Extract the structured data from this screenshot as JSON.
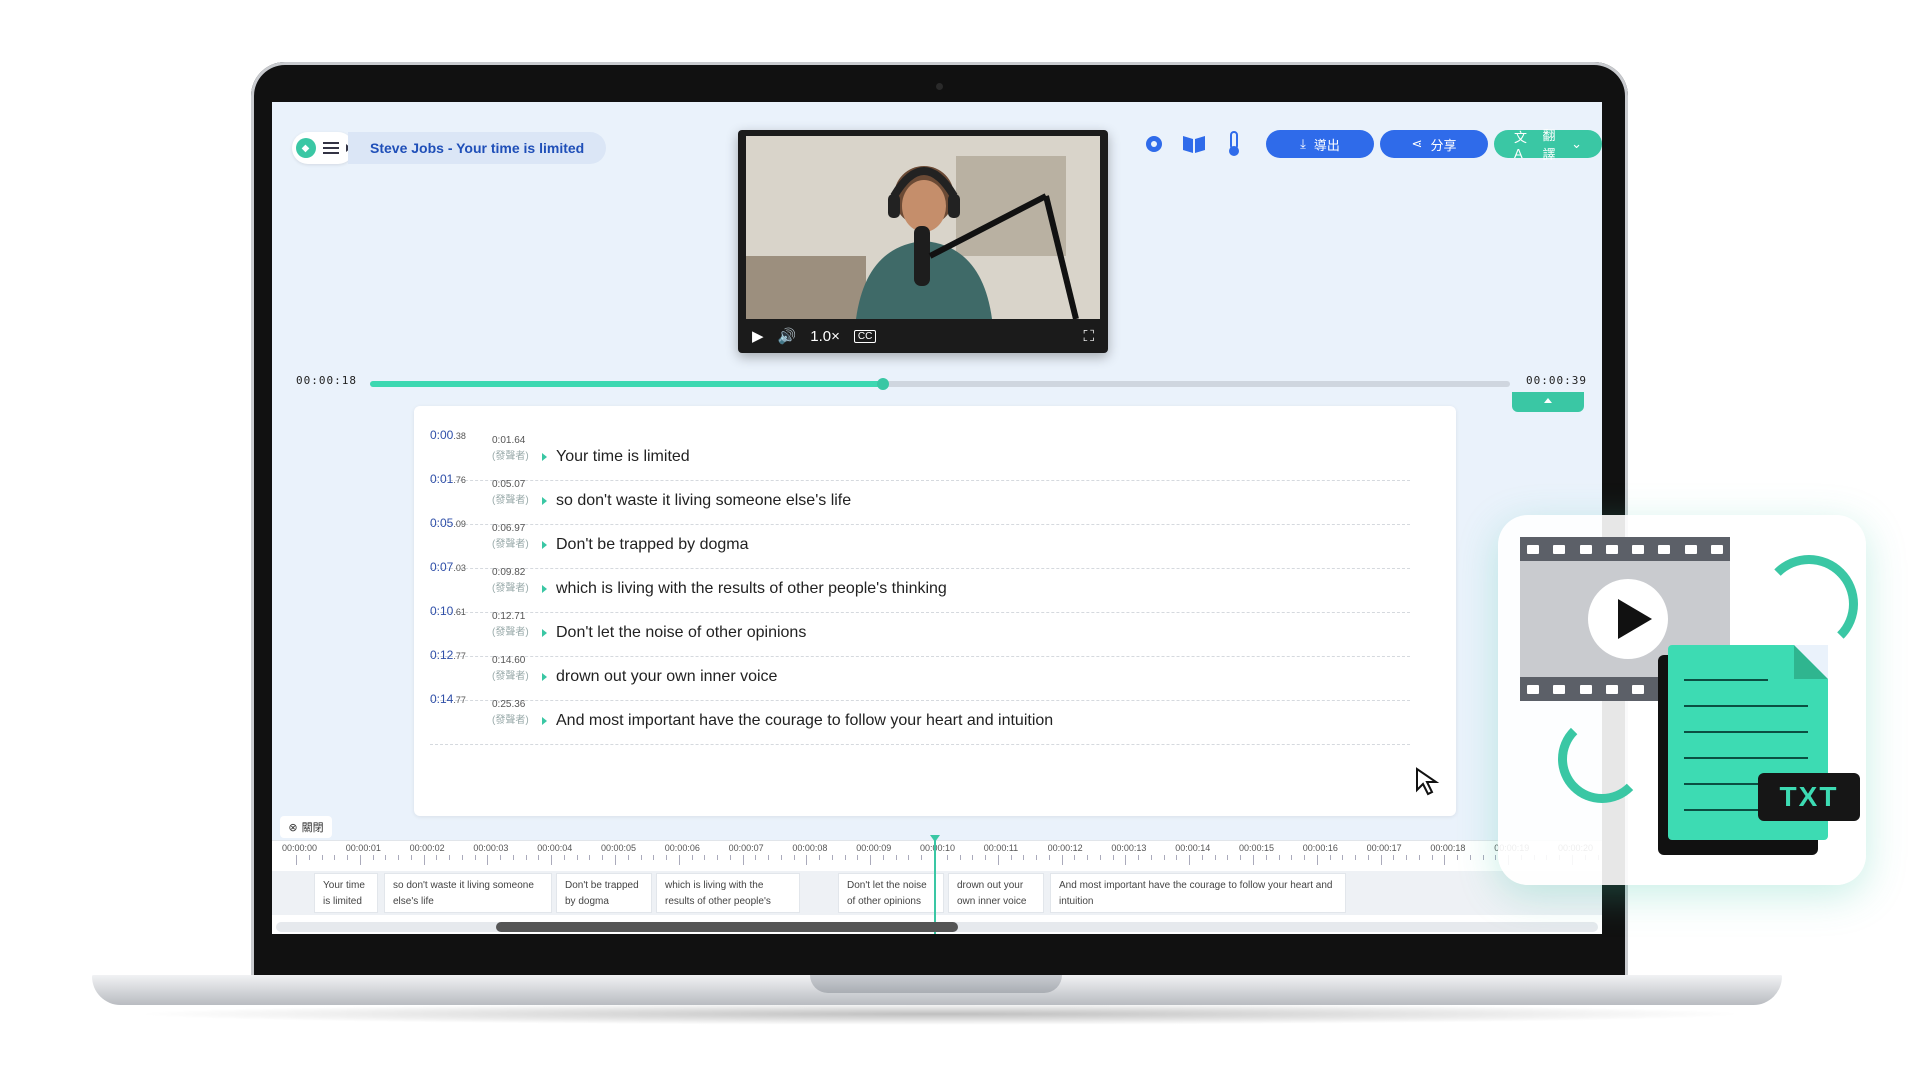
{
  "app": {
    "title": "Steve Jobs - Your time is limited"
  },
  "video": {
    "speed": "1.0×"
  },
  "toolbar": {
    "export_label": "導出",
    "share_label": "分享",
    "translate_label": "翻譯"
  },
  "playback": {
    "current_time": "00:00:18",
    "total_time": "00:00:39",
    "progress": 0.45
  },
  "transcript": [
    {
      "start_main": "0:00",
      "start_frac": ".38",
      "end": "0:01.64",
      "speaker": "(發聲者)",
      "text": "Your time is limited"
    },
    {
      "start_main": "0:01",
      "start_frac": ".76",
      "end": "0:05.07",
      "speaker": "(發聲者)",
      "text": "so don't waste it living someone else's life"
    },
    {
      "start_main": "0:05",
      "start_frac": ".09",
      "end": "0:06.97",
      "speaker": "(發聲者)",
      "text": "Don't be trapped by dogma"
    },
    {
      "start_main": "0:07",
      "start_frac": ".03",
      "end": "0:09.82",
      "speaker": "(發聲者)",
      "text": "which is living with the results of other people's thinking"
    },
    {
      "start_main": "0:10",
      "start_frac": ".61",
      "end": "0:12.71",
      "speaker": "(發聲者)",
      "text": "Don't let the noise of other opinions"
    },
    {
      "start_main": "0:12",
      "start_frac": ".77",
      "end": "0:14.60",
      "speaker": "(發聲者)",
      "text": "drown out your own inner voice"
    },
    {
      "start_main": "0:14",
      "start_frac": ".77",
      "end": "0:25.36",
      "speaker": "(發聲者)",
      "text": "And most important have the courage to follow your heart and intuition"
    }
  ],
  "timeline": {
    "close_label": "關閉",
    "ticks": [
      "00:00:00",
      "00:00:01",
      "00:00:02",
      "00:00:03",
      "00:00:04",
      "00:00:05",
      "00:00:06",
      "00:00:07",
      "00:00:08",
      "00:00:09",
      "00:00:10",
      "00:00:11",
      "00:00:12",
      "00:00:13",
      "00:00:14",
      "00:00:15",
      "00:00:16",
      "00:00:17",
      "00:00:18",
      "00:00:19",
      "00:00:20"
    ],
    "segments": [
      "Your time is limited",
      "so don't waste it living someone else's life",
      "Don't be trapped by dogma",
      "which is living with the results of other people's thinking",
      "Don't let the noise of other opinions",
      "drown out your own inner voice",
      "And most important have the courage to follow your heart and intuition"
    ]
  },
  "promo": {
    "badge": "TXT"
  },
  "colors": {
    "accent": "#3ac7a4",
    "brand_blue": "#2f6bea",
    "title_blue": "#1f4fb8"
  },
  "icons": [
    "menu-icon",
    "gear-icon",
    "book-icon",
    "thermometer-icon",
    "download-icon",
    "share-icon",
    "translate-icon",
    "play-icon",
    "volume-icon",
    "cc-icon",
    "fullscreen-icon"
  ]
}
